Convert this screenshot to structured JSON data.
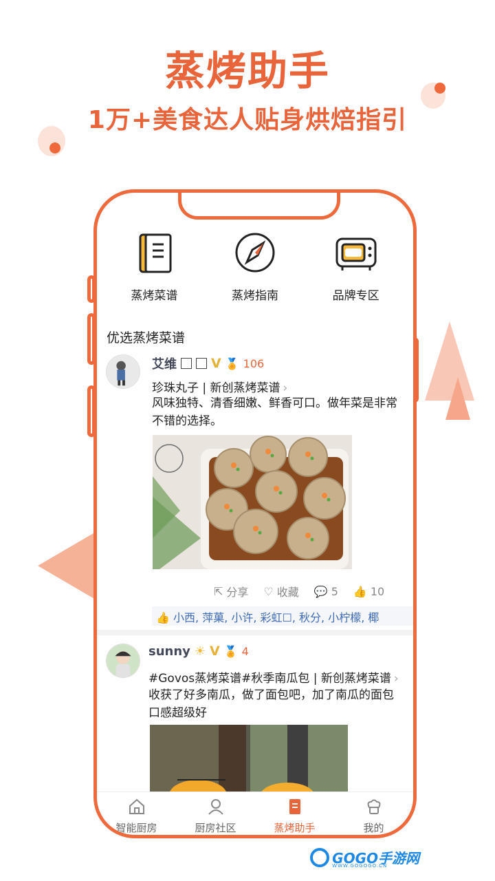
{
  "hero": {
    "title": "蒸烤助手",
    "subtitle": "1万+美食达人贴身烘焙指引"
  },
  "shortcuts": [
    {
      "label": "蒸烤菜谱",
      "icon": "recipe-book-icon"
    },
    {
      "label": "蒸烤指南",
      "icon": "compass-icon"
    },
    {
      "label": "品牌专区",
      "icon": "oven-icon"
    }
  ],
  "section_title": "优选蒸烤菜谱",
  "post1": {
    "username": "艾维",
    "badge_v": "V",
    "medal_count": "106",
    "topic": "珍珠丸子 | 新创蒸烤菜谱",
    "description": "风味独特、清香细嫩、鲜香可口。做年菜是非常不错的选择。",
    "actions": {
      "share": "分享",
      "collect": "收藏",
      "comments": "5",
      "likes": "10"
    },
    "liked_by": "小西, 萍菓, 小许, 彩虹☐, 秋分, 小柠檬, 椰"
  },
  "post2": {
    "username": "sunny",
    "badge_v": "V",
    "medal_count": "4",
    "topic": "#Govos蒸烤菜谱#秋季南瓜包 | 新创蒸烤菜谱",
    "description": "收获了好多南瓜，做了面包吧，加了南瓜的面包口感超级好"
  },
  "tabs": [
    {
      "label": "智能厨房",
      "icon": "home-icon",
      "active": false
    },
    {
      "label": "厨房社区",
      "icon": "community-icon",
      "active": false
    },
    {
      "label": "蒸烤助手",
      "icon": "assistant-icon",
      "active": true
    },
    {
      "label": "我的",
      "icon": "chef-hat-icon",
      "active": false
    }
  ],
  "watermark": {
    "brand": "GOGO手游网",
    "url": "WWW.GOGOGO.CN"
  },
  "colors": {
    "accent": "#e8643a",
    "link": "#3f6bb5"
  }
}
